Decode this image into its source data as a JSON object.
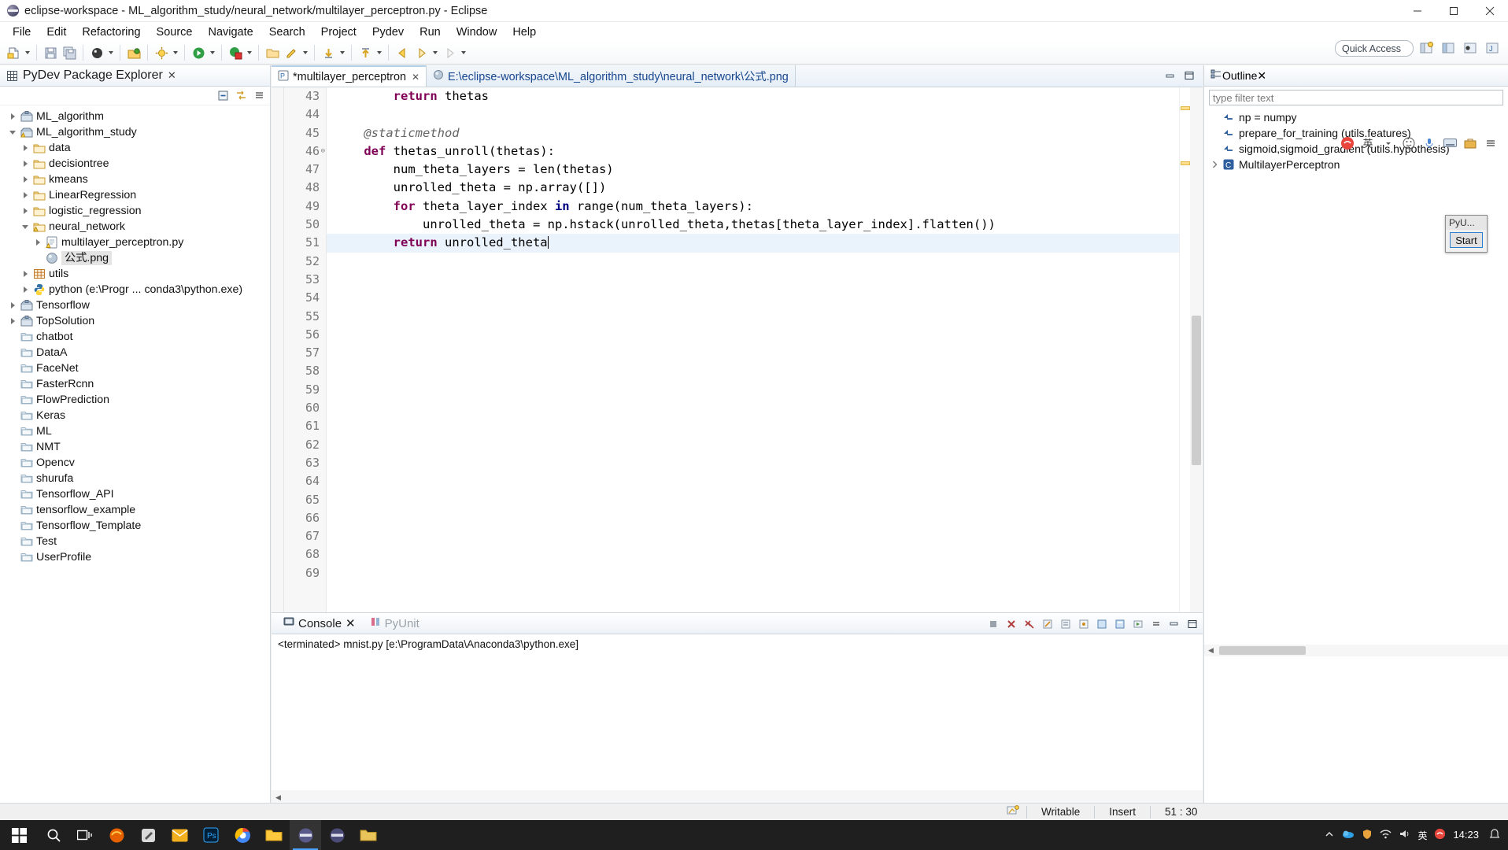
{
  "window": {
    "title": "eclipse-workspace - ML_algorithm_study/neural_network/multilayer_perceptron.py - Eclipse",
    "minimize": "—",
    "maximize": "▢",
    "close": "✕"
  },
  "menubar": {
    "items": [
      "File",
      "Edit",
      "Refactoring",
      "Source",
      "Navigate",
      "Search",
      "Project",
      "Pydev",
      "Run",
      "Window",
      "Help"
    ]
  },
  "toolbar": {
    "quick_access": "Quick Access",
    "icons": [
      "new-file-icon",
      "save-icon",
      "save-all-icon",
      "debug-icon",
      "open-resource-icon",
      "build-icon",
      "run-icon",
      "coverage-icon",
      "open-folder-icon",
      "pydev-icon",
      "next-annotation-icon",
      "previous-annotation-icon",
      "back-icon",
      "forward-icon"
    ],
    "perspective_icons": [
      "open-perspective-icon",
      "pydev-perspective-icon",
      "debug-perspective-icon",
      "java-perspective-icon"
    ]
  },
  "package_explorer": {
    "title": "PyDev Package Explorer",
    "close_label": "✕",
    "toolbar_icons": [
      "collapse-all-icon",
      "link-with-editor-icon",
      "view-menu-icon"
    ],
    "tree": [
      {
        "label": "ML_algorithm",
        "indent": 0,
        "twist": "collapsed",
        "icon": "project-icon"
      },
      {
        "label": "ML_algorithm_study",
        "indent": 0,
        "twist": "expanded",
        "icon": "project-warning-icon"
      },
      {
        "label": "data",
        "indent": 1,
        "twist": "collapsed",
        "icon": "folder-icon"
      },
      {
        "label": "decisiontree",
        "indent": 1,
        "twist": "collapsed",
        "icon": "folder-icon"
      },
      {
        "label": "kmeans",
        "indent": 1,
        "twist": "collapsed",
        "icon": "folder-icon"
      },
      {
        "label": "LinearRegression",
        "indent": 1,
        "twist": "collapsed",
        "icon": "folder-icon"
      },
      {
        "label": "logistic_regression",
        "indent": 1,
        "twist": "collapsed",
        "icon": "folder-icon"
      },
      {
        "label": "neural_network",
        "indent": 1,
        "twist": "expanded",
        "icon": "folder-warning-icon"
      },
      {
        "label": "multilayer_perceptron.py",
        "indent": 2,
        "twist": "collapsed",
        "icon": "python-file-warning-icon"
      },
      {
        "label": "公式.png",
        "indent": 2,
        "twist": "none",
        "icon": "image-file-icon",
        "selected": true
      },
      {
        "label": "utils",
        "indent": 1,
        "twist": "collapsed",
        "icon": "source-folder-icon"
      },
      {
        "label": "python  (e:\\Progr ... conda3\\python.exe)",
        "indent": 1,
        "twist": "collapsed",
        "icon": "python-interpreter-icon"
      },
      {
        "label": "Tensorflow",
        "indent": 0,
        "twist": "collapsed",
        "icon": "project-icon"
      },
      {
        "label": "TopSolution",
        "indent": 0,
        "twist": "collapsed",
        "icon": "project-icon"
      },
      {
        "label": "chatbot",
        "indent": 0,
        "twist": "none",
        "icon": "closed-folder-icon"
      },
      {
        "label": "DataA",
        "indent": 0,
        "twist": "none",
        "icon": "closed-folder-icon"
      },
      {
        "label": "FaceNet",
        "indent": 0,
        "twist": "none",
        "icon": "closed-folder-icon"
      },
      {
        "label": "FasterRcnn",
        "indent": 0,
        "twist": "none",
        "icon": "closed-folder-icon"
      },
      {
        "label": "FlowPrediction",
        "indent": 0,
        "twist": "none",
        "icon": "closed-folder-icon"
      },
      {
        "label": "Keras",
        "indent": 0,
        "twist": "none",
        "icon": "closed-folder-icon"
      },
      {
        "label": "ML",
        "indent": 0,
        "twist": "none",
        "icon": "closed-folder-icon"
      },
      {
        "label": "NMT",
        "indent": 0,
        "twist": "none",
        "icon": "closed-folder-icon"
      },
      {
        "label": "Opencv",
        "indent": 0,
        "twist": "none",
        "icon": "closed-folder-icon"
      },
      {
        "label": "shurufa",
        "indent": 0,
        "twist": "none",
        "icon": "closed-folder-icon"
      },
      {
        "label": "Tensorflow_API",
        "indent": 0,
        "twist": "none",
        "icon": "closed-folder-icon"
      },
      {
        "label": "tensorflow_example",
        "indent": 0,
        "twist": "none",
        "icon": "closed-folder-icon"
      },
      {
        "label": "Tensorflow_Template",
        "indent": 0,
        "twist": "none",
        "icon": "closed-folder-icon"
      },
      {
        "label": "Test",
        "indent": 0,
        "twist": "none",
        "icon": "closed-folder-icon"
      },
      {
        "label": "UserProfile",
        "indent": 0,
        "twist": "none",
        "icon": "closed-folder-icon"
      }
    ]
  },
  "editor": {
    "tabs": [
      {
        "label": "*multilayer_perceptron",
        "icon": "python-file-icon",
        "active": true,
        "closable": true
      },
      {
        "label": "E:\\eclipse-workspace\\ML_algorithm_study\\neural_network\\公式.png",
        "icon": "image-file-icon",
        "active": false,
        "closable": false
      }
    ],
    "minimize": "—",
    "maximize": "▢",
    "first_line_number": 43,
    "last_line_number": 69,
    "highlight_line": 51,
    "fold_marker_line": 46,
    "lines": [
      {
        "no": 43,
        "text": "        return thetas",
        "tokens": [
          {
            "t": "        ",
            "c": ""
          },
          {
            "t": "return",
            "c": "kw"
          },
          {
            "t": " thetas",
            "c": ""
          }
        ]
      },
      {
        "no": 44,
        "text": "",
        "tokens": []
      },
      {
        "no": 45,
        "text": "    @staticmethod",
        "tokens": [
          {
            "t": "    ",
            "c": ""
          },
          {
            "t": "@staticmethod",
            "c": "deco"
          }
        ]
      },
      {
        "no": 46,
        "text": "    def thetas_unroll(thetas):",
        "tokens": [
          {
            "t": "    ",
            "c": ""
          },
          {
            "t": "def",
            "c": "kw"
          },
          {
            "t": " thetas_unroll(thetas):",
            "c": ""
          }
        ]
      },
      {
        "no": 47,
        "text": "        num_theta_layers = len(thetas)",
        "tokens": [
          {
            "t": "        num_theta_layers = len(thetas)",
            "c": ""
          }
        ]
      },
      {
        "no": 48,
        "text": "        unrolled_theta = np.array([])",
        "tokens": [
          {
            "t": "        unrolled_theta = np.array([])",
            "c": ""
          }
        ]
      },
      {
        "no": 49,
        "text": "        for theta_layer_index in range(num_theta_layers):",
        "tokens": [
          {
            "t": "        ",
            "c": ""
          },
          {
            "t": "for",
            "c": "kw"
          },
          {
            "t": " theta_layer_index ",
            "c": ""
          },
          {
            "t": "in",
            "c": "kw2"
          },
          {
            "t": " range(num_theta_layers):",
            "c": ""
          }
        ]
      },
      {
        "no": 50,
        "text": "            unrolled_theta = np.hstack(unrolled_theta,thetas[theta_layer_index].flatten())",
        "tokens": [
          {
            "t": "            unrolled_theta = np.hstack(unrolled_theta,thetas[theta_layer_index].flatten())",
            "c": ""
          }
        ]
      },
      {
        "no": 51,
        "text": "        return unrolled_theta",
        "tokens": [
          {
            "t": "        ",
            "c": ""
          },
          {
            "t": "return",
            "c": "kw"
          },
          {
            "t": " unrolled_theta",
            "c": ""
          }
        ]
      },
      {
        "no": 52,
        "text": "",
        "tokens": []
      },
      {
        "no": 53,
        "text": "",
        "tokens": []
      },
      {
        "no": 54,
        "text": "",
        "tokens": []
      },
      {
        "no": 55,
        "text": "",
        "tokens": []
      },
      {
        "no": 56,
        "text": "",
        "tokens": []
      },
      {
        "no": 57,
        "text": "",
        "tokens": []
      },
      {
        "no": 58,
        "text": "",
        "tokens": []
      },
      {
        "no": 59,
        "text": "",
        "tokens": []
      },
      {
        "no": 60,
        "text": "",
        "tokens": []
      },
      {
        "no": 61,
        "text": "",
        "tokens": []
      },
      {
        "no": 62,
        "text": "",
        "tokens": []
      },
      {
        "no": 63,
        "text": "",
        "tokens": []
      },
      {
        "no": 64,
        "text": "",
        "tokens": []
      },
      {
        "no": 65,
        "text": "",
        "tokens": []
      },
      {
        "no": 66,
        "text": "",
        "tokens": []
      },
      {
        "no": 67,
        "text": "",
        "tokens": []
      },
      {
        "no": 68,
        "text": "",
        "tokens": []
      },
      {
        "no": 69,
        "text": "",
        "tokens": []
      }
    ]
  },
  "console": {
    "tabs": [
      {
        "label": "Console",
        "icon": "console-icon",
        "active": true,
        "closable": true
      },
      {
        "label": "PyUnit",
        "icon": "pyunit-icon",
        "active": false,
        "closable": false
      }
    ],
    "output": "<terminated> mnist.py [e:\\ProgramData\\Anaconda3\\python.exe]",
    "tool_icons": [
      "terminate-icon",
      "remove-launch-icon",
      "remove-all-icon",
      "clear-console-icon",
      "scroll-lock-icon",
      "pin-console-icon",
      "show-console-icon",
      "display-selected-icon",
      "open-console-icon",
      "console-menu-icon",
      "minimize-icon",
      "maximize-icon"
    ]
  },
  "outline": {
    "title": "Outline",
    "close_label": "✕",
    "filter_placeholder": "type filter text",
    "tool_icons": [
      "sogou-ime-icon",
      "chinese-mode-icon",
      "emoji-icon",
      "mic-icon",
      "keyboard-icon",
      "toolbox-icon",
      "menu-icon"
    ],
    "items": [
      {
        "label": "np = numpy",
        "icon": "attribute-icon",
        "twist": "none"
      },
      {
        "label": "prepare_for_training (utils.features)",
        "icon": "attribute-icon",
        "twist": "none"
      },
      {
        "label": "sigmoid,sigmoid_gradient (utils.hypothesis)",
        "icon": "attribute-icon",
        "twist": "none"
      },
      {
        "label": "MultilayerPerceptron",
        "icon": "class-icon",
        "twist": "collapsed"
      }
    ]
  },
  "popup": {
    "title": "PyU...",
    "button_label": "Start"
  },
  "statusbar": {
    "writable": "Writable",
    "insert": "Insert",
    "position": "51 : 30",
    "icon": "smart-insert-icon"
  },
  "taskbar": {
    "start_icon": "windows-start-icon",
    "items": [
      "search-icon",
      "task-view-icon",
      "firefox-icon",
      "tools-icon",
      "mail-icon",
      "ps-icon",
      "chrome-icon",
      "explorer-icon",
      "eclipse-icon",
      "eclipse2-icon",
      "folder-icon"
    ],
    "tray": [
      "chevron-up-icon",
      "onedrive-icon",
      "shield-icon",
      "network-icon",
      "volume-icon",
      "ime-icon",
      "sogou-icon"
    ],
    "clock_time": "14:23"
  },
  "colors": {
    "accent": "#2f7fd0",
    "keyword": "#7f0055",
    "keyword_blue": "#000080",
    "decorator": "#646464",
    "selection": "#eaf2fb",
    "panel_border": "#cfd6dc"
  }
}
